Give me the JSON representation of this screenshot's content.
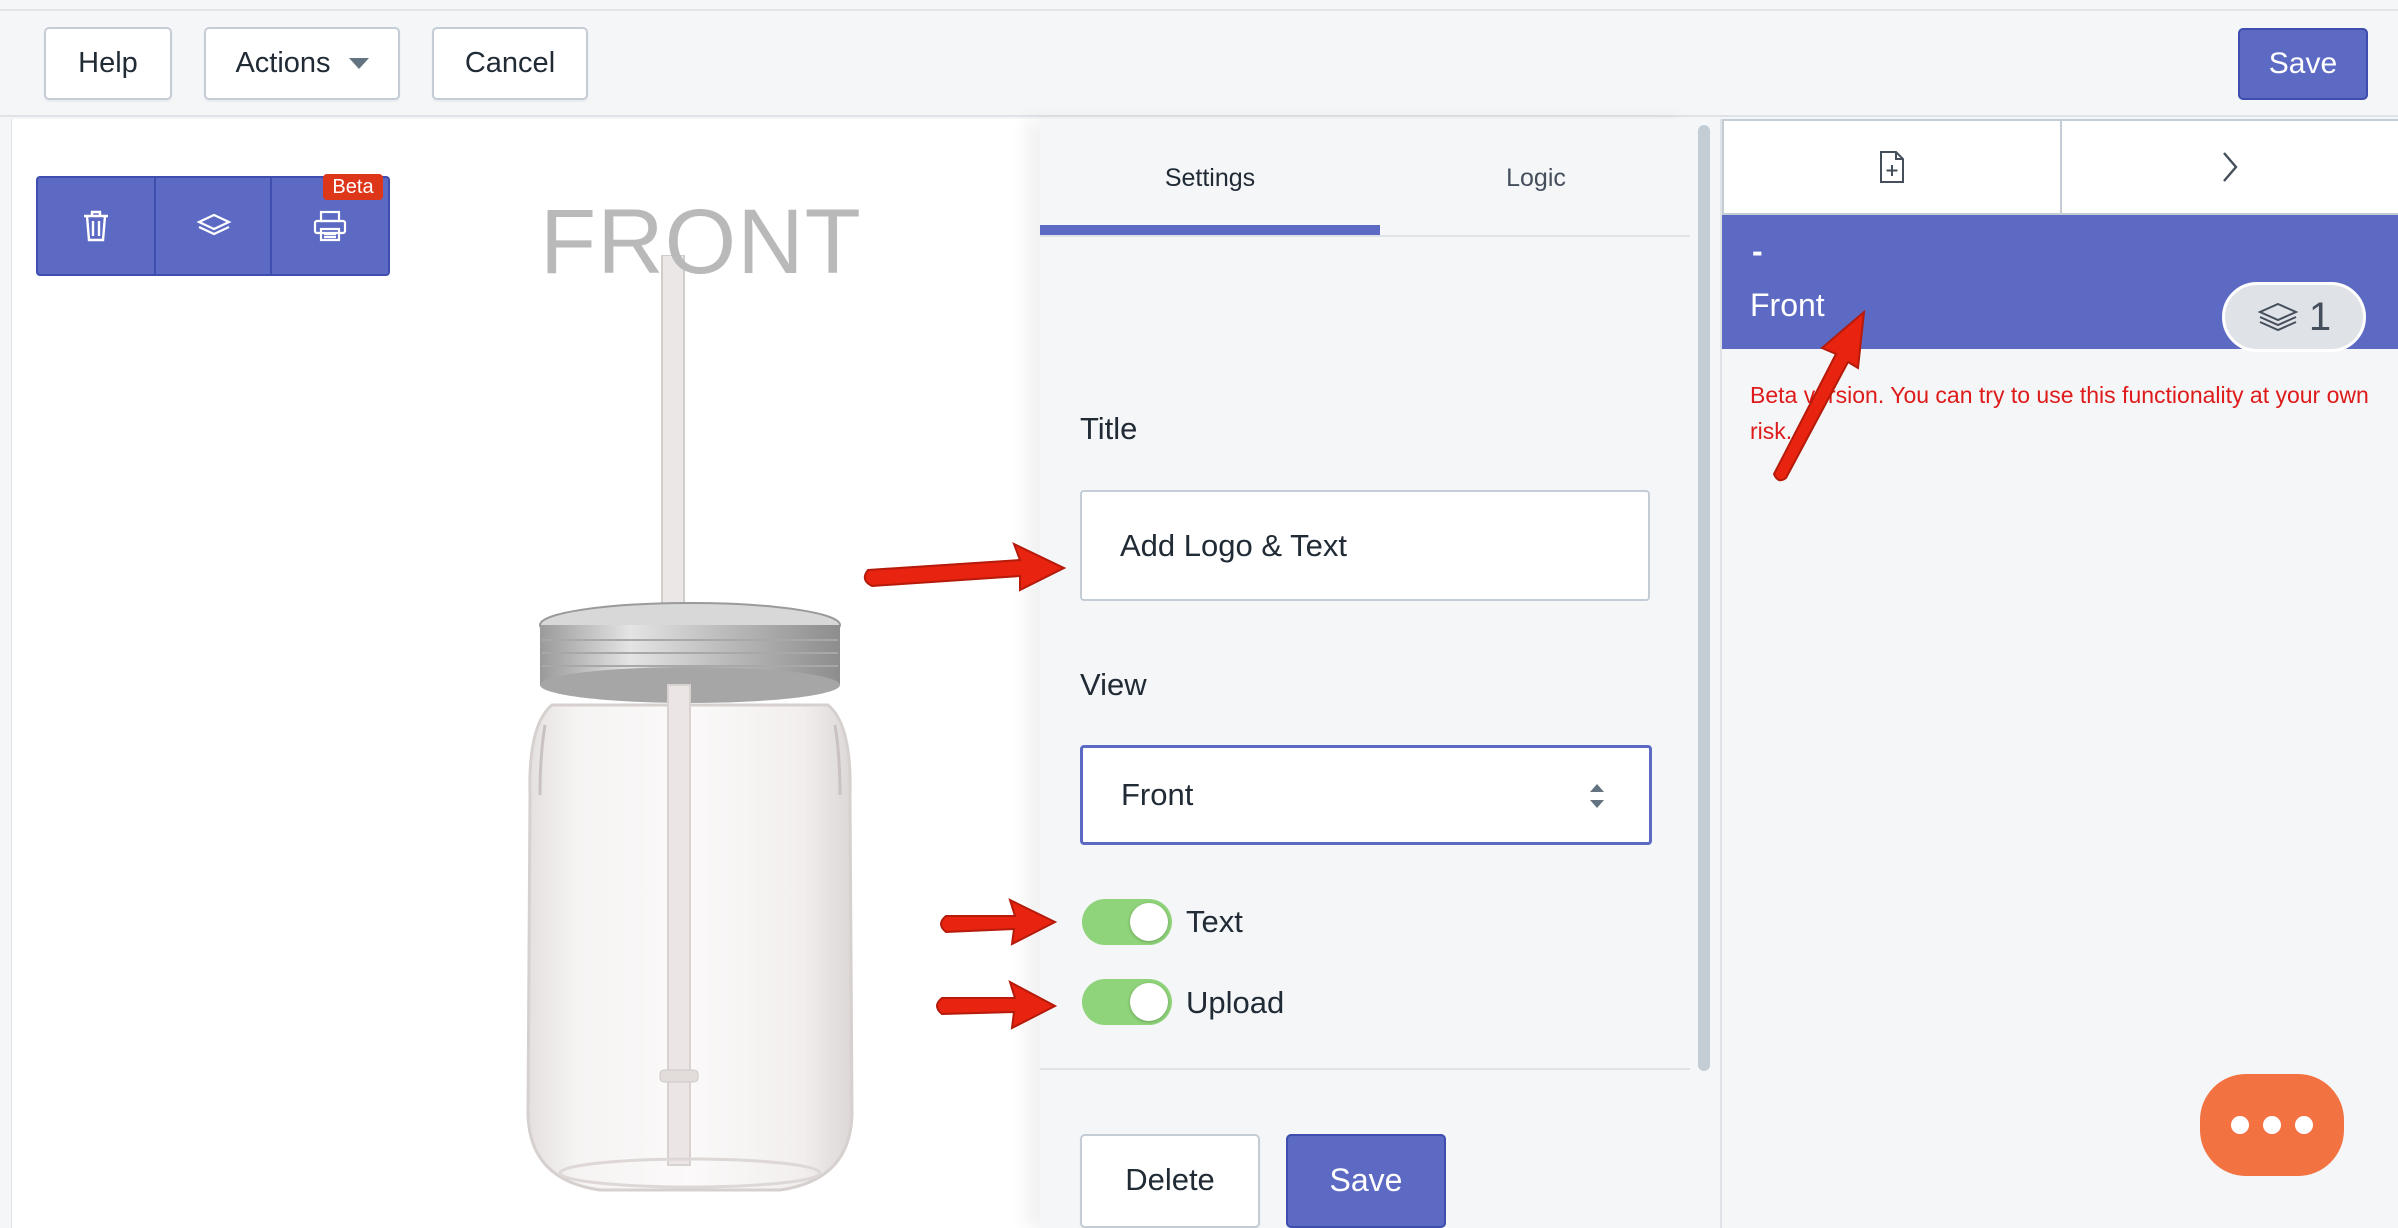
{
  "toolbar": {
    "help": "Help",
    "actions": "Actions",
    "cancel": "Cancel",
    "save": "Save"
  },
  "canvas": {
    "view_label": "FRONT",
    "tools": [
      "trash-icon",
      "layers-icon",
      "printer-icon"
    ],
    "beta_badge": "Beta"
  },
  "panel": {
    "tabs": [
      {
        "label": "Settings",
        "active": true
      },
      {
        "label": "Logic",
        "active": false
      }
    ],
    "title_label": "Title",
    "title_value": "Add Logo & Text",
    "view_label": "View",
    "view_value": "Front",
    "toggles": [
      {
        "label": "Text",
        "on": true
      },
      {
        "label": "Upload",
        "on": true
      }
    ],
    "delete": "Delete",
    "save": "Save"
  },
  "right": {
    "buttons": [
      "add-page-icon",
      "chevron-right-icon"
    ],
    "view_dash": "-",
    "view_name": "Front",
    "layer_count": "1",
    "beta_notice": "Beta version. You can try to use this functionality at your own risk."
  },
  "colors": {
    "primary": "#5c6ac4",
    "danger": "#de3618",
    "toggle_on": "#8fd37a",
    "chat": "#f27242",
    "annotation_arrow": "#e8230f"
  }
}
